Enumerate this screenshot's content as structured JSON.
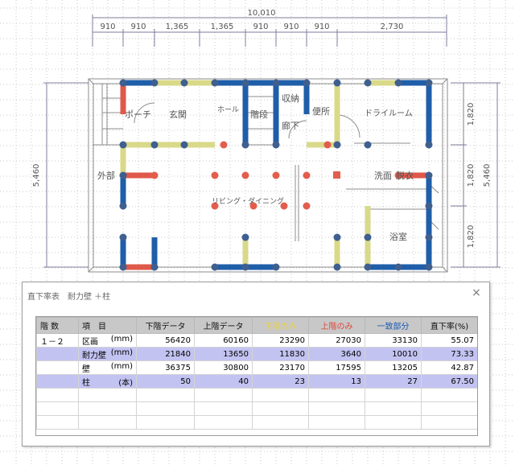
{
  "plan": {
    "dims_top_total": "10,010",
    "dims_top": [
      "910",
      "910",
      "1,365",
      "1,365",
      "910",
      "910",
      "910",
      "2,730"
    ],
    "dims_left": "5,460",
    "dims_right": [
      "1,820",
      "1,820",
      "1,820"
    ],
    "dims_right_total": "5,460",
    "rooms": {
      "porch": "ポーチ",
      "entrance": "玄関",
      "hall": "ホール",
      "stairs": "階段",
      "storage": "収納",
      "corridor": "廊下",
      "toilet": "便所",
      "dry_room": "ドライルーム",
      "exterior": "外部",
      "living_dining": "リビング・ダイニング",
      "washroom": "洗面",
      "washroom_extra": "脱衣",
      "bathroom": "浴室"
    },
    "colors": {
      "bearing_wall": "#1f5ea8",
      "lower_only_wall": "#d9d98a",
      "upper_only_wall": "#e0584a",
      "pillar": "#3f5f8f",
      "upper_pillar": "#e35d4d"
    }
  },
  "dialog": {
    "title": "直下率表　耐力壁 ＋柱",
    "close_icon": "×"
  },
  "table": {
    "headers": [
      {
        "text": "階 数",
        "color": "#111111"
      },
      {
        "text": "項　目",
        "color": "#111111"
      },
      {
        "text": "下階データ",
        "color": "#111111"
      },
      {
        "text": "上階データ",
        "color": "#111111"
      },
      {
        "text": "下階のみ",
        "color": "#e8d24a"
      },
      {
        "text": "上階のみ",
        "color": "#e0473a"
      },
      {
        "text": "一致部分",
        "color": "#1a57b5"
      },
      {
        "text": "直下率(%)",
        "color": "#111111"
      }
    ],
    "rows": [
      {
        "floor": "１－２",
        "item": "区画",
        "unit": "(mm)",
        "lower": "56420",
        "upper": "60160",
        "lower_only": "23290",
        "upper_only": "27030",
        "match": "33130",
        "rate": "55.07",
        "highlight": false
      },
      {
        "floor": "",
        "item": "耐力壁",
        "unit": "(mm)",
        "lower": "21840",
        "upper": "13650",
        "lower_only": "11830",
        "upper_only": "3640",
        "match": "10010",
        "rate": "73.33",
        "highlight": true
      },
      {
        "floor": "",
        "item": "壁",
        "unit": "(mm)",
        "lower": "36375",
        "upper": "30800",
        "lower_only": "23170",
        "upper_only": "17595",
        "match": "13205",
        "rate": "42.87",
        "highlight": false
      },
      {
        "floor": "",
        "item": "柱",
        "unit": "(本)",
        "lower": "50",
        "upper": "40",
        "lower_only": "23",
        "upper_only": "13",
        "match": "27",
        "rate": "67.50",
        "highlight": true
      }
    ]
  }
}
